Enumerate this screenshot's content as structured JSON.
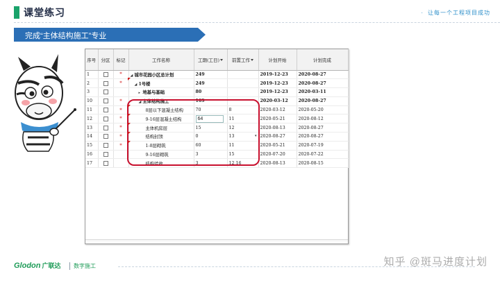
{
  "header": {
    "title": "课堂练习",
    "slogan": "让每一个工程项目成功",
    "banner": "完成“主体结构施工”专业"
  },
  "grid": {
    "columns": {
      "no": "序号",
      "zone": "分区",
      "mark": "标记",
      "name": "工作名称",
      "duration": "工期(工日)",
      "pred": "前置工作",
      "start": "计划开始",
      "finish": "计划完成"
    },
    "rows": [
      {
        "no": "1",
        "mark": "*",
        "name": "城市花园小区总计划",
        "duration": "249",
        "pred": "",
        "start": "2019-12-23",
        "finish": "2020-08-27"
      },
      {
        "no": "2",
        "mark": "*",
        "name": "1号楼",
        "duration": "249",
        "pred": "",
        "start": "2019-12-23",
        "finish": "2020-08-27"
      },
      {
        "no": "3",
        "mark": "",
        "name": "地基与基础",
        "duration": "80",
        "pred": "",
        "start": "2019-12-23",
        "finish": "2020-03-11"
      },
      {
        "no": "10",
        "mark": "*",
        "name": "主体结构施工",
        "duration": "169",
        "pred": "",
        "start": "2020-03-12",
        "finish": "2020-08-27"
      },
      {
        "no": "11",
        "mark": "*",
        "name": "8层以下混凝土结构",
        "duration": "70",
        "pred": "8",
        "start": "2020-03-12",
        "finish": "2020-05-20"
      },
      {
        "no": "12",
        "mark": "*",
        "name": "9-16层混凝土结构",
        "duration": "64",
        "pred": "11",
        "start": "2020-05-21",
        "finish": "2020-08-12"
      },
      {
        "no": "13",
        "mark": "*",
        "name": "主体机房层",
        "duration": "15",
        "pred": "12",
        "start": "2020-08-13",
        "finish": "2020-08-27"
      },
      {
        "no": "14",
        "mark": "*",
        "name": "结构封顶",
        "duration": "0",
        "pred": "13",
        "start": "2020-08-27",
        "finish": "2020-08-27"
      },
      {
        "no": "15",
        "mark": "*",
        "name": "1-8层砌筑",
        "duration": "60",
        "pred": "11",
        "start": "2020-05-21",
        "finish": "2020-07-19"
      },
      {
        "no": "16",
        "mark": "",
        "name": "9-16层砌筑",
        "duration": "3",
        "pred": "15",
        "start": "2020-07-20",
        "finish": "2020-07-22"
      },
      {
        "no": "17",
        "mark": "",
        "name": "结构验收",
        "duration": "3",
        "pred": "12,16",
        "start": "2020-08-13",
        "finish": "2020-08-15"
      }
    ]
  },
  "footer": {
    "logo": "Glodon",
    "logo_cn": "广联达",
    "sub": "数字施工",
    "watermark": "知乎 @斑马进度计划"
  },
  "colors": {
    "brand_green": "#1aa36b",
    "banner_blue": "#2b6fb6",
    "highlight_red": "#c8102e"
  }
}
